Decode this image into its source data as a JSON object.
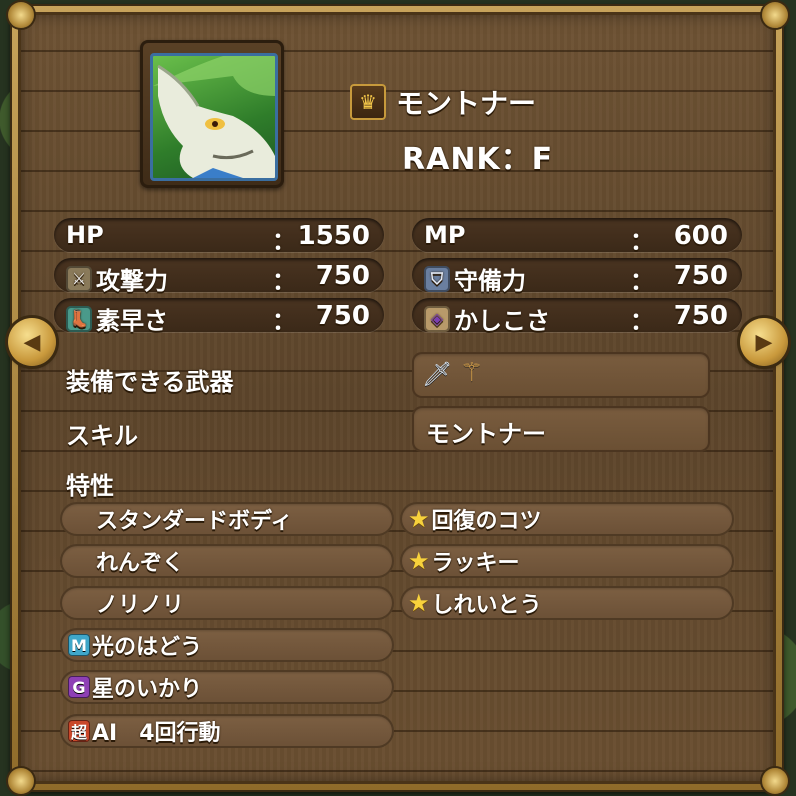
{
  "monster": {
    "name": "モントナー",
    "rank": "RANK：F",
    "crown_icon": "crown-icon"
  },
  "stats": {
    "hp": {
      "label": "HP",
      "colon": "：",
      "value": "1550"
    },
    "mp": {
      "label": "MP",
      "colon": "：",
      "value": "600"
    },
    "attack": {
      "label": "攻撃力",
      "colon": "：",
      "value": "750",
      "icon": "sword-icon"
    },
    "defense": {
      "label": "守備力",
      "colon": "：",
      "value": "750",
      "icon": "shield-icon"
    },
    "speed": {
      "label": "素早さ",
      "colon": "：",
      "value": "750",
      "icon": "boot-icon"
    },
    "wisdom": {
      "label": "かしこさ",
      "colon": "：",
      "value": "750",
      "icon": "necklace-icon"
    }
  },
  "equipment": {
    "label": "装備できる武器",
    "icons": [
      "sword-icon",
      "staff-icon"
    ]
  },
  "skill": {
    "label": "スキル",
    "value": "モントナー"
  },
  "traits": {
    "label": "特性",
    "left": [
      {
        "text": "スタンダードボディ",
        "tag": ""
      },
      {
        "text": "れんぞく",
        "tag": ""
      },
      {
        "text": "ノリノリ",
        "tag": ""
      },
      {
        "text": "光のはどう",
        "tag": "M",
        "tag_color": "#3fa7c9"
      },
      {
        "text": "星のいかり",
        "tag": "G",
        "tag_color": "#8e3fb5"
      },
      {
        "text": "AI　4回行動",
        "tag": "超",
        "tag_color": "#c9472a"
      }
    ],
    "right": [
      {
        "text": "回復のコツ",
        "star": "★"
      },
      {
        "text": "ラッキー",
        "star": "★"
      },
      {
        "text": "しれいとう",
        "star": "★"
      }
    ]
  },
  "nav": {
    "prev": "◀",
    "next": "▶"
  }
}
